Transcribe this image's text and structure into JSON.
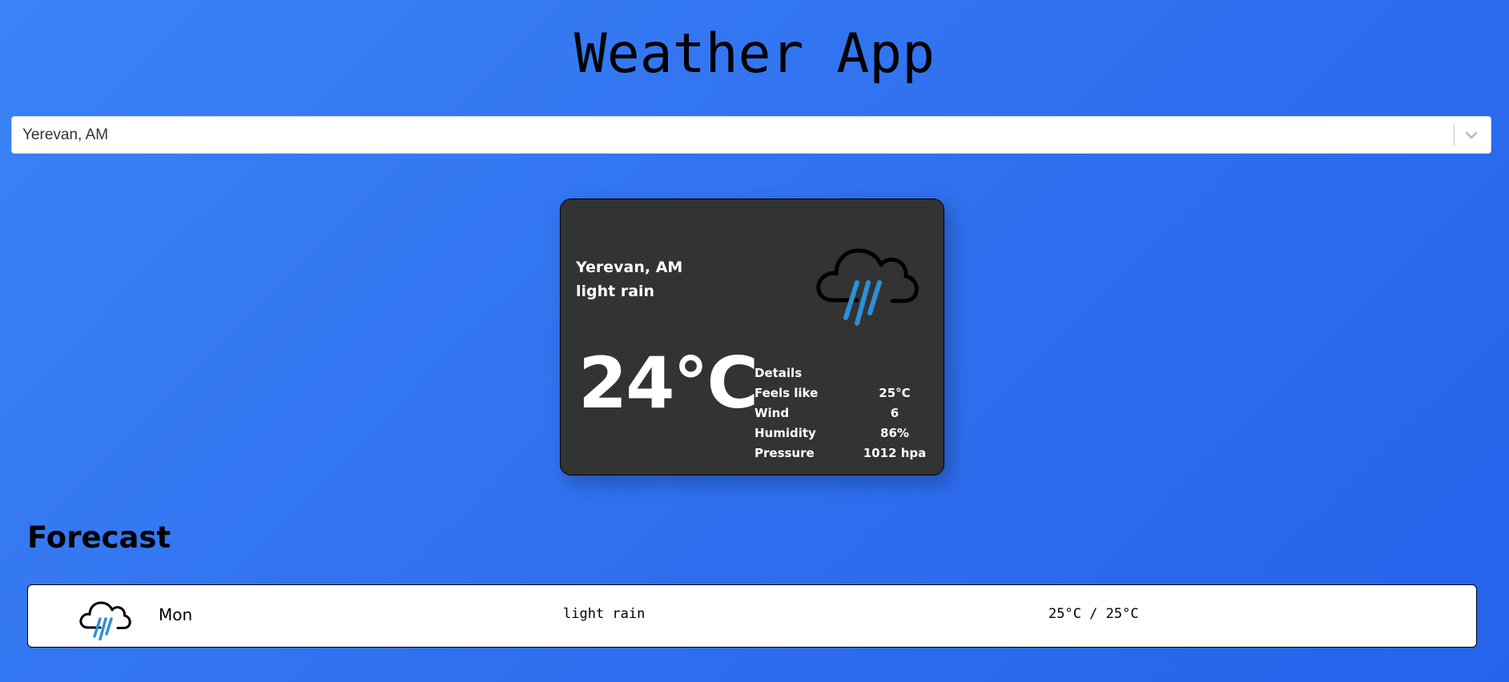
{
  "app": {
    "title": "Weather App"
  },
  "search": {
    "value": "Yerevan, AM",
    "dropdown_icon": "chevron-down-icon"
  },
  "current": {
    "city": "Yerevan, AM",
    "description": "light rain",
    "icon": "rain-cloud-icon",
    "temperature": "24°C",
    "details": {
      "title": "Details",
      "rows": [
        {
          "label": "Feels like",
          "value": "25°C"
        },
        {
          "label": "Wind",
          "value": "6"
        },
        {
          "label": "Humidity",
          "value": "86%"
        },
        {
          "label": "Pressure",
          "value": "1012 hpa"
        }
      ]
    }
  },
  "forecast": {
    "title": "Forecast",
    "items": [
      {
        "day": "Mon",
        "icon": "rain-cloud-icon",
        "description": "light rain",
        "temp_range": "25°C / 25°C"
      }
    ]
  },
  "colors": {
    "background_start": "#3b82f6",
    "background_end": "#2563eb",
    "card_background": "#333333",
    "rain_accent": "#2f8fd6"
  }
}
